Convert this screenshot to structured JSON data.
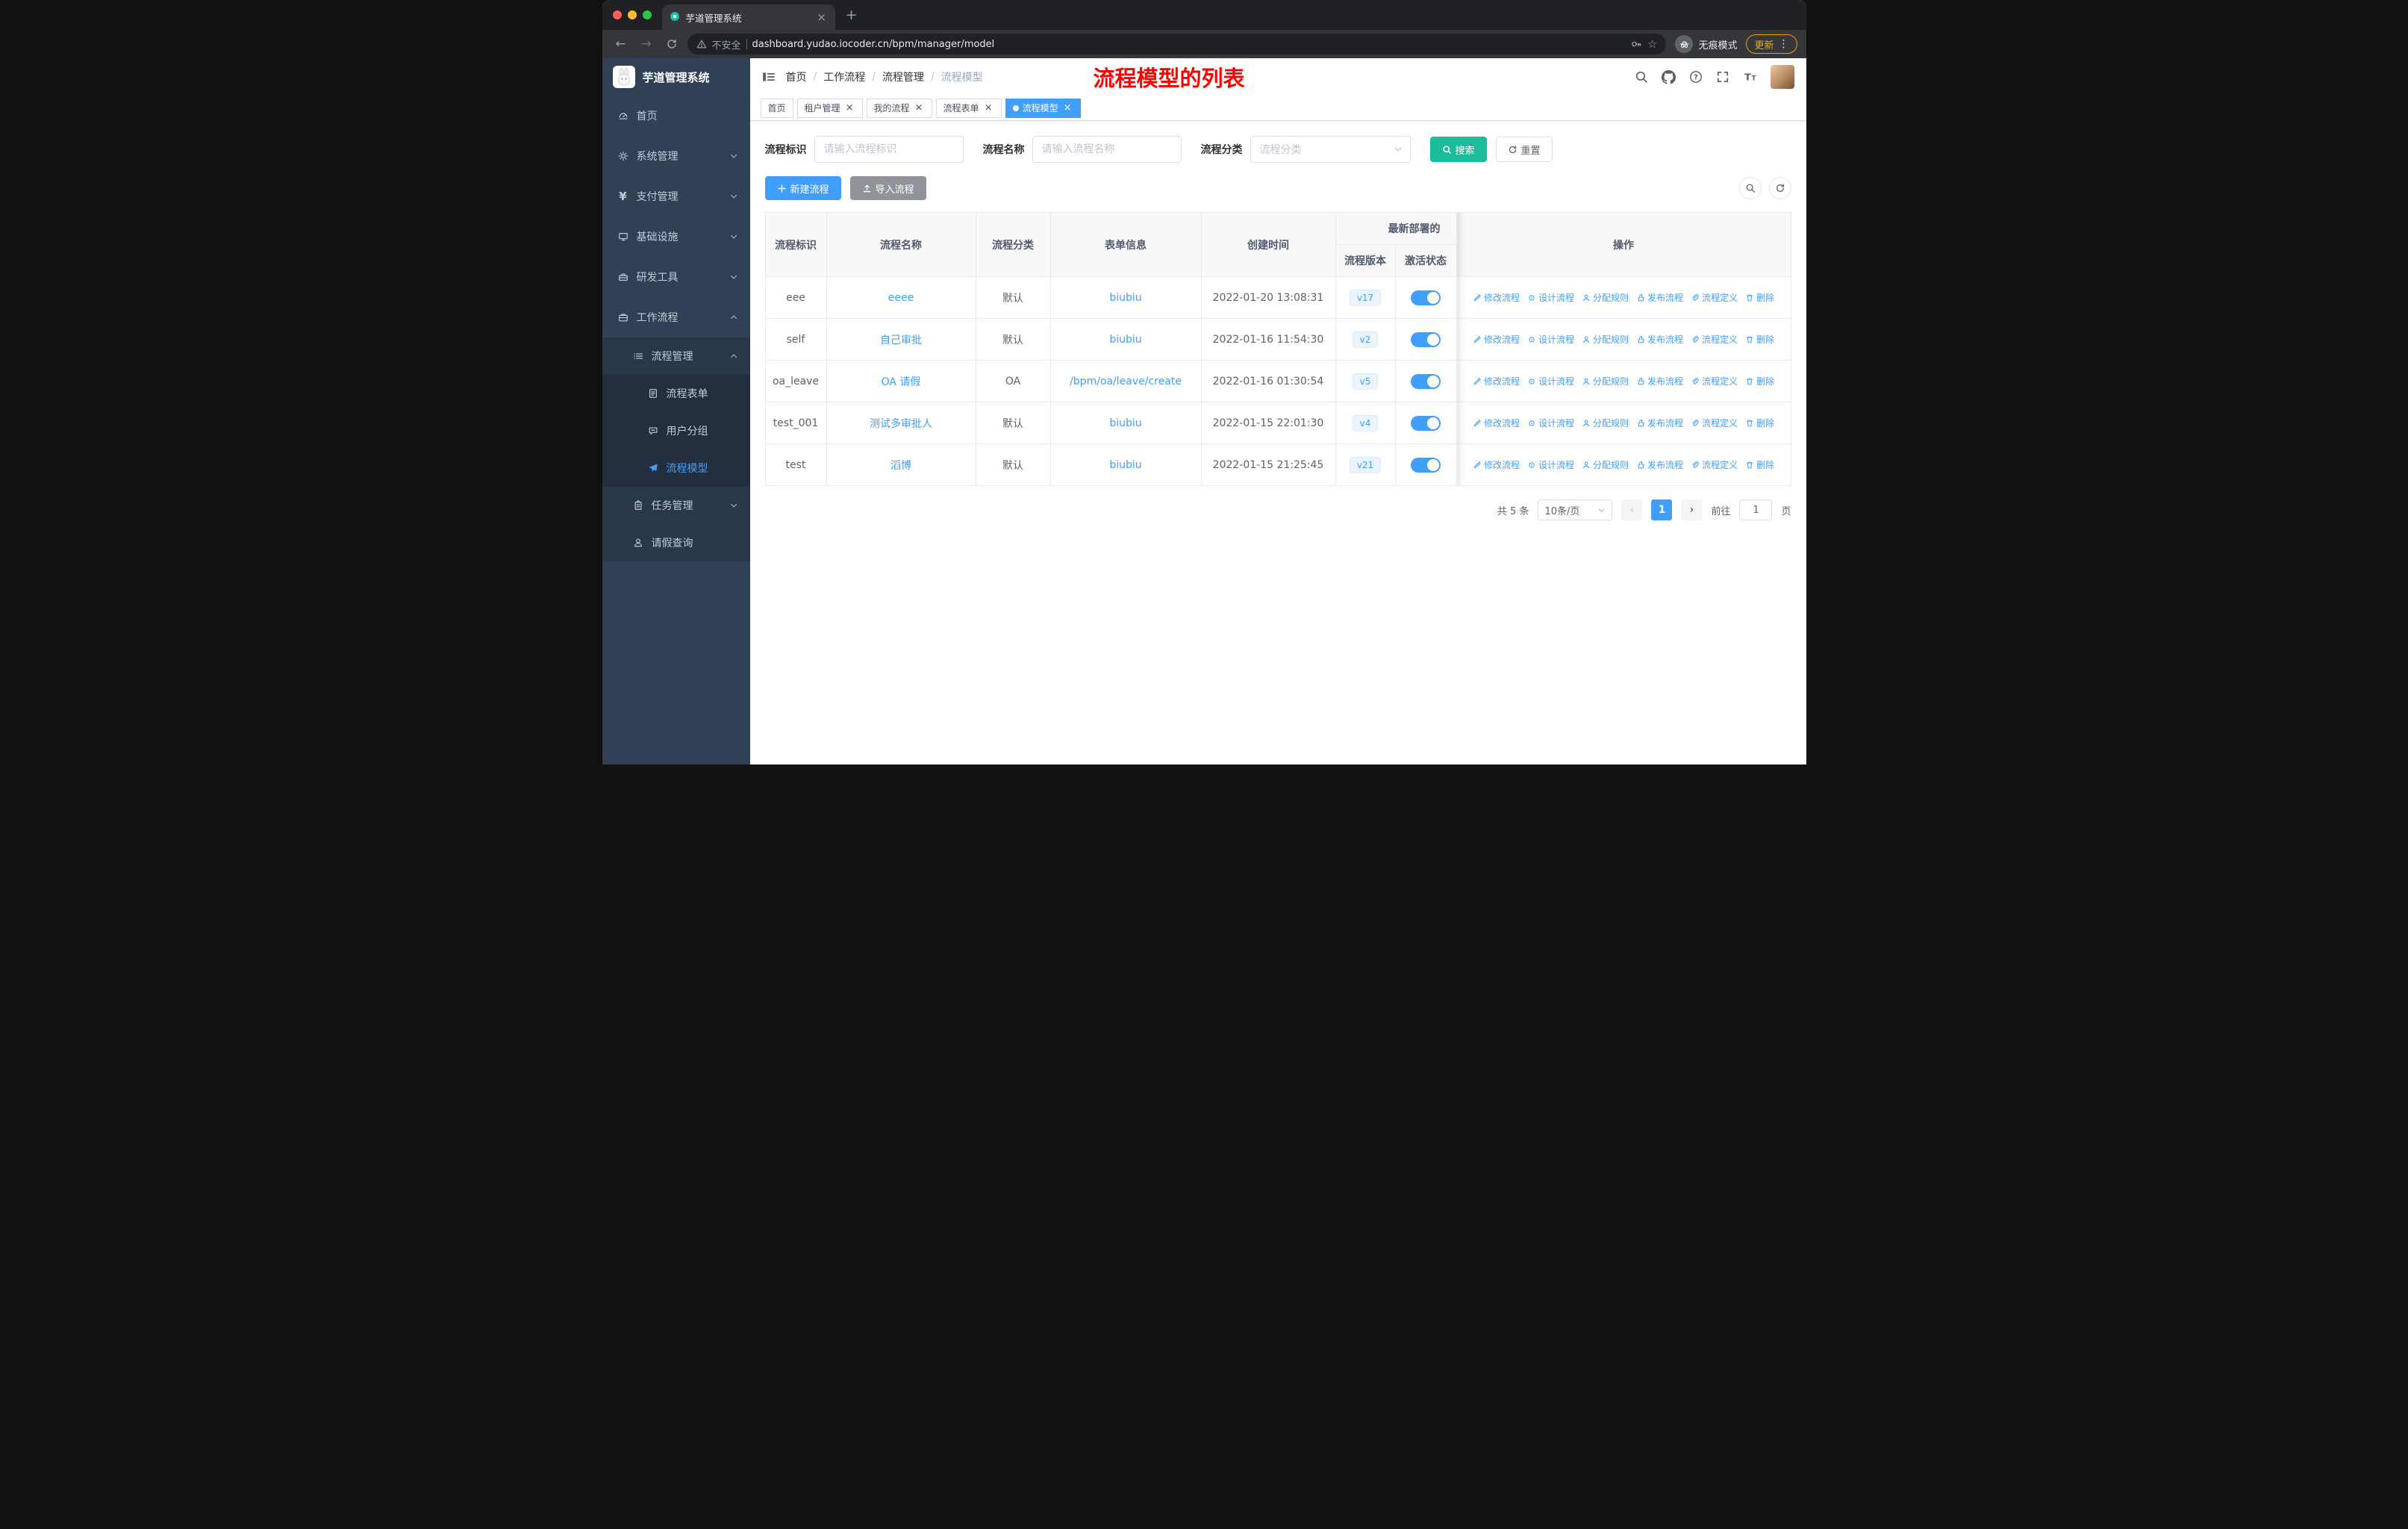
{
  "browser": {
    "tab": {
      "title": "芋道管理系统",
      "close": "×",
      "new_tab": "+"
    },
    "nav": {
      "back": "←",
      "forward": "→"
    },
    "address": {
      "security": "不安全",
      "url": "dashboard.yudao.iocoder.cn/bpm/manager/model"
    },
    "right": {
      "incognito": "无痕模式",
      "update": "更新",
      "kebab": "⋮"
    }
  },
  "sidebar": {
    "logo": "芋道管理系统",
    "menu": [
      {
        "key": "home",
        "icon": "dashboard",
        "label": "首页"
      },
      {
        "key": "system",
        "icon": "gear",
        "label": "系统管理",
        "arrow": "down"
      },
      {
        "key": "payment",
        "icon": "yen",
        "label": "支付管理",
        "arrow": "down"
      },
      {
        "key": "infra",
        "icon": "monitor",
        "label": "基础设施",
        "arrow": "down"
      },
      {
        "key": "devtools",
        "icon": "toolbox",
        "label": "研发工具",
        "arrow": "down"
      },
      {
        "key": "workflow",
        "icon": "briefcase",
        "label": "工作流程",
        "arrow": "up",
        "children": [
          {
            "key": "process-mgmt",
            "icon": "list",
            "label": "流程管理",
            "arrow": "up",
            "children": [
              {
                "key": "process-form",
                "icon": "document",
                "label": "流程表单"
              },
              {
                "key": "user-group",
                "icon": "chat",
                "label": "用户分组"
              },
              {
                "key": "process-model",
                "icon": "send",
                "label": "流程模型",
                "active": true
              }
            ]
          },
          {
            "key": "task-mgmt",
            "icon": "clipboard",
            "label": "任务管理",
            "arrow": "down"
          },
          {
            "key": "leave-query",
            "icon": "person",
            "label": "请假查询"
          }
        ]
      }
    ]
  },
  "header": {
    "breadcrumb": [
      "首页",
      "工作流程",
      "流程管理",
      "流程模型"
    ],
    "annotation": "流程模型的列表"
  },
  "tags": [
    {
      "label": "首页",
      "closable": false
    },
    {
      "label": "租户管理",
      "closable": true
    },
    {
      "label": "我的流程",
      "closable": true
    },
    {
      "label": "流程表单",
      "closable": true
    },
    {
      "label": "流程模型",
      "closable": true,
      "active": true
    }
  ],
  "filters": {
    "id_label": "流程标识",
    "id_placeholder": "请输入流程标识",
    "name_label": "流程名称",
    "name_placeholder": "请输入流程名称",
    "category_label": "流程分类",
    "category_placeholder": "流程分类",
    "search": "搜索",
    "reset": "重置"
  },
  "toolbar": {
    "create": "新建流程",
    "import": "导入流程"
  },
  "table": {
    "headers": {
      "id": "流程标识",
      "name": "流程名称",
      "category": "流程分类",
      "form": "表单信息",
      "created": "创建时间",
      "deploy_group": "最新部署的",
      "version": "流程版本",
      "active": "激活状态",
      "actions": "操作"
    },
    "row_actions": [
      {
        "key": "edit",
        "label": "修改流程"
      },
      {
        "key": "design",
        "label": "设计流程"
      },
      {
        "key": "assign",
        "label": "分配规则"
      },
      {
        "key": "publish",
        "label": "发布流程"
      },
      {
        "key": "definition",
        "label": "流程定义"
      },
      {
        "key": "delete",
        "label": "删除"
      }
    ],
    "rows": [
      {
        "id": "eee",
        "name": "eeee",
        "category": "默认",
        "form": "biubiu",
        "created": "2022-01-20 13:08:31",
        "version": "v17",
        "active": true
      },
      {
        "id": "self",
        "name": "自己审批",
        "category": "默认",
        "form": "biubiu",
        "created": "2022-01-16 11:54:30",
        "version": "v2",
        "active": true
      },
      {
        "id": "oa_leave",
        "name": "OA 请假",
        "category": "OA",
        "form": "/bpm/oa/leave/create",
        "created": "2022-01-16 01:30:54",
        "version": "v5",
        "active": true
      },
      {
        "id": "test_001",
        "name": "测试多审批人",
        "category": "默认",
        "form": "biubiu",
        "created": "2022-01-15 22:01:30",
        "version": "v4",
        "active": true
      },
      {
        "id": "test",
        "name": "滔博",
        "category": "默认",
        "form": "biubiu",
        "created": "2022-01-15 21:25:45",
        "version": "v21",
        "active": true
      }
    ]
  },
  "pagination": {
    "total": "共 5 条",
    "page_size": "10条/页",
    "prev": "‹",
    "next": "›",
    "current": "1",
    "goto": "前往",
    "goto_value": "1",
    "page_unit": "页"
  },
  "colors": {
    "accent": "#409eff",
    "search_button": "#1abc9c",
    "annotation": "#ff0000",
    "sidebar_bg": "#304156"
  }
}
